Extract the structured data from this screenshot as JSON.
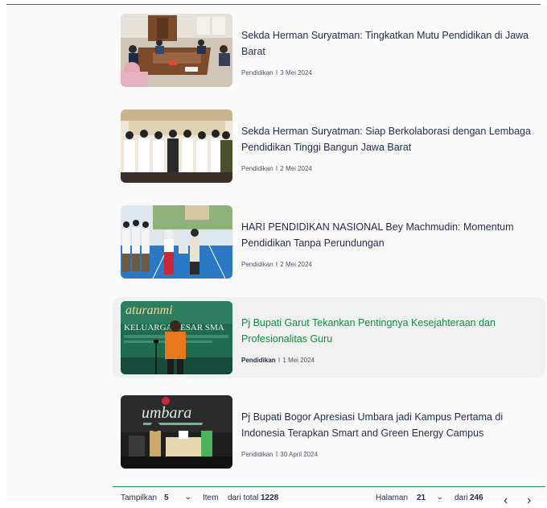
{
  "articles": [
    {
      "title": "Sekda Herman Suryatman: Tingkatkan Mutu Pendidikan di Jawa Barat",
      "category": "Pendidikan",
      "separator": "I",
      "date": "3 Mei 2024",
      "image": "photo-meeting-room"
    },
    {
      "title": "Sekda Herman Suryatman: Siap Berkolaborasi dengan Lembaga Pendidikan Tinggi Bangun Jawa Barat",
      "category": "Pendidikan",
      "separator": "I",
      "date": "2 Mei 2024",
      "image": "photo-group-salute"
    },
    {
      "title": "HARI PENDIDIKAN NASIONAL Bey Machmudin: Momentum Pendidikan Tanpa Perundungan",
      "category": "Pendidikan",
      "separator": "I",
      "date": "2 Mei 2024",
      "image": "photo-students-ceremony"
    },
    {
      "title": "Pj Bupati Garut Tekankan Pentingnya Kesejahteraan dan Profesionalitas Guru",
      "category": "Pendidikan",
      "separator": "I",
      "date": "1 Mei 2024",
      "image": "photo-speaker-banner",
      "banner_text_1": "aturanmi",
      "banner_text_2": "KELUARGA BESAR SMA"
    },
    {
      "title": "Pj Bupati Bogor Apresiasi Umbara jadi Kampus Pertama di Indonesia Terapkan Smart and Green Energy Campus",
      "category": "Pendidikan",
      "separator": "I",
      "date": "30 April 2024",
      "image": "photo-umbara-stage",
      "banner_text": "umbara"
    }
  ],
  "pager": {
    "show_label": "Tampilkan",
    "per_page": "5",
    "item_label": "Item",
    "total_prefix": "dari total",
    "total": "1228",
    "page_label": "Halaman",
    "page": "21",
    "page_of": "dari",
    "page_count": "246",
    "prev_icon": "chevron-left-icon",
    "next_icon": "chevron-right-icon"
  },
  "colors": {
    "accent_green": "#14873f",
    "title_navy": "#1e2b4d",
    "highlight_bg": "#f1f1f2"
  }
}
